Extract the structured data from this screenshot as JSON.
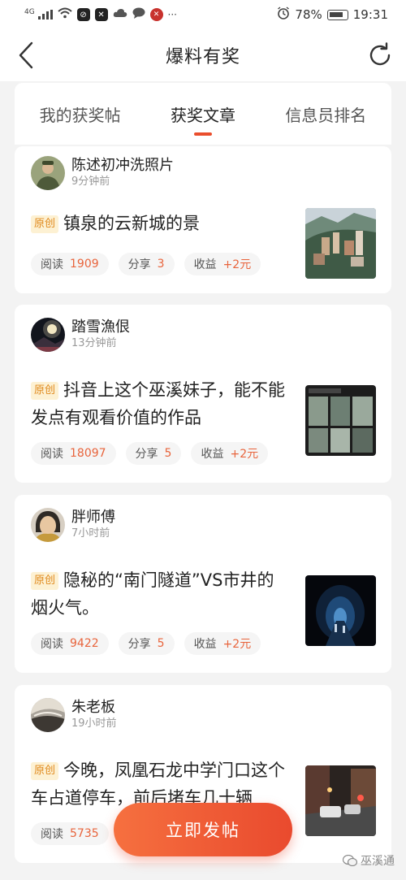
{
  "status_bar": {
    "network": "4G",
    "battery_percent": "78%",
    "time": "19:31"
  },
  "nav": {
    "title": "爆料有奖",
    "back_icon": "chevron-left-icon",
    "refresh_icon": "refresh-icon"
  },
  "tabs": [
    {
      "label": "我的获奖帖",
      "active": false
    },
    {
      "label": "获奖文章",
      "active": true
    },
    {
      "label": "信息员排名",
      "active": false
    }
  ],
  "posts": [
    {
      "author": "陈述初冲洗照片",
      "time": "9分钟前",
      "badge": "原创",
      "title": "镇泉的云新城的景",
      "read_label": "阅读",
      "read_value": "1909",
      "share_label": "分享",
      "share_value": "3",
      "earn_label": "收益",
      "earn_value": "+2元"
    },
    {
      "author": "踏雪漁佷",
      "time": "13分钟前",
      "badge": "原创",
      "title": "抖音上这个巫溪妹子，能不能发点有观看价值的作品",
      "read_label": "阅读",
      "read_value": "18097",
      "share_label": "分享",
      "share_value": "5",
      "earn_label": "收益",
      "earn_value": "+2元"
    },
    {
      "author": "胖师傅",
      "time": "7小时前",
      "badge": "原创",
      "title": "隐秘的“南门隧道”VS市井的烟火气。",
      "read_label": "阅读",
      "read_value": "9422",
      "share_label": "分享",
      "share_value": "5",
      "earn_label": "收益",
      "earn_value": "+2元"
    },
    {
      "author": "朱老板",
      "time": "19小时前",
      "badge": "原创",
      "title": "今晚，凤凰石龙中学门口这个车占道停车，前后堵车几十辆",
      "read_label": "阅读",
      "read_value": "5735"
    }
  ],
  "post_button": "立即发帖",
  "watermark": "巫溪通",
  "colors": {
    "accent": "#ea4e2d",
    "stat_value": "#e8643c",
    "badge_bg": "#fdf1d3",
    "badge_text": "#e08a1e"
  }
}
